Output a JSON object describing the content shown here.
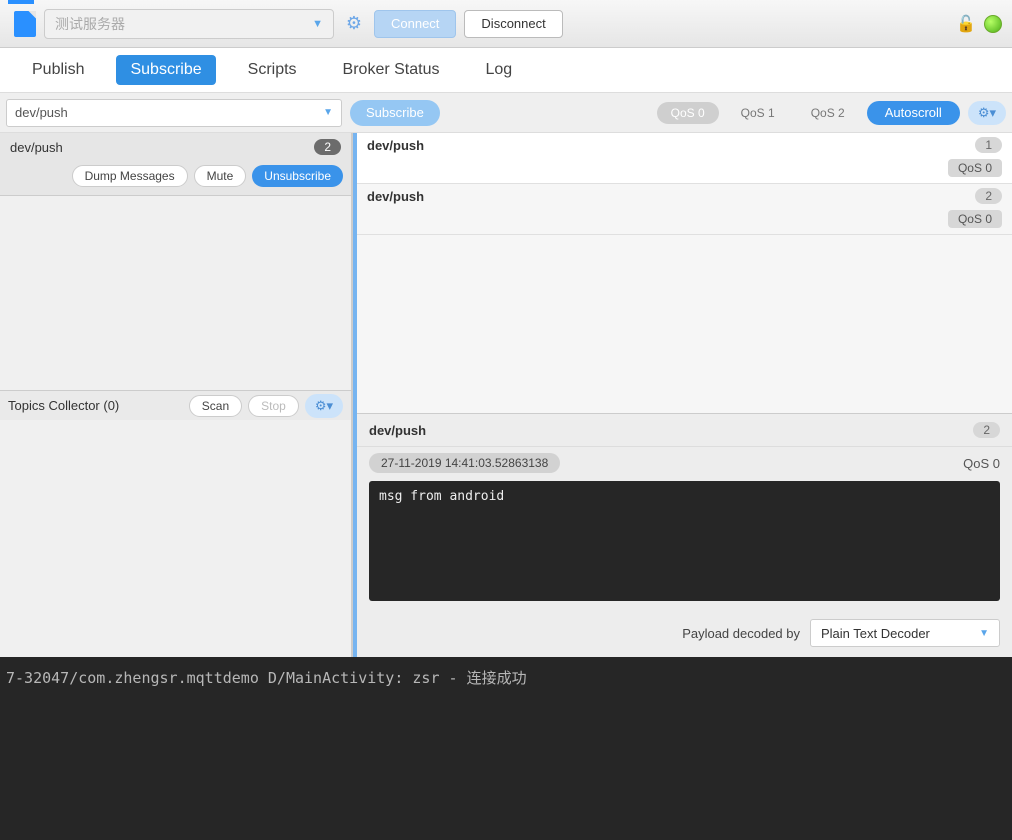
{
  "toolbar": {
    "server_placeholder": "测试服务器",
    "connect_label": "Connect",
    "disconnect_label": "Disconnect"
  },
  "tabs": {
    "publish": "Publish",
    "subscribe": "Subscribe",
    "scripts": "Scripts",
    "broker_status": "Broker Status",
    "log": "Log"
  },
  "sub_bar": {
    "topic_value": "dev/push",
    "subscribe_label": "Subscribe",
    "qos0": "QoS 0",
    "qos1": "QoS 1",
    "qos2": "QoS 2",
    "autoscroll": "Autoscroll"
  },
  "left": {
    "subscription": {
      "topic": "dev/push",
      "count": "2",
      "dump": "Dump Messages",
      "mute": "Mute",
      "unsubscribe": "Unsubscribe"
    },
    "topics_collector": {
      "label": "Topics Collector (0)",
      "scan": "Scan",
      "stop": "Stop"
    }
  },
  "messages": [
    {
      "topic": "dev/push",
      "index": "1",
      "qos": "QoS 0"
    },
    {
      "topic": "dev/push",
      "index": "2",
      "qos": "QoS 0"
    }
  ],
  "detail": {
    "topic": "dev/push",
    "index": "2",
    "timestamp": "27-11-2019 14:41:03.52863138",
    "qos": "QoS 0",
    "payload": "msg from android",
    "decoder_label": "Payload decoded by",
    "decoder_value": "Plain Text Decoder"
  },
  "console": {
    "line": "7-32047/com.zhengsr.mqttdemo D/MainActivity: zsr - 连接成功"
  }
}
